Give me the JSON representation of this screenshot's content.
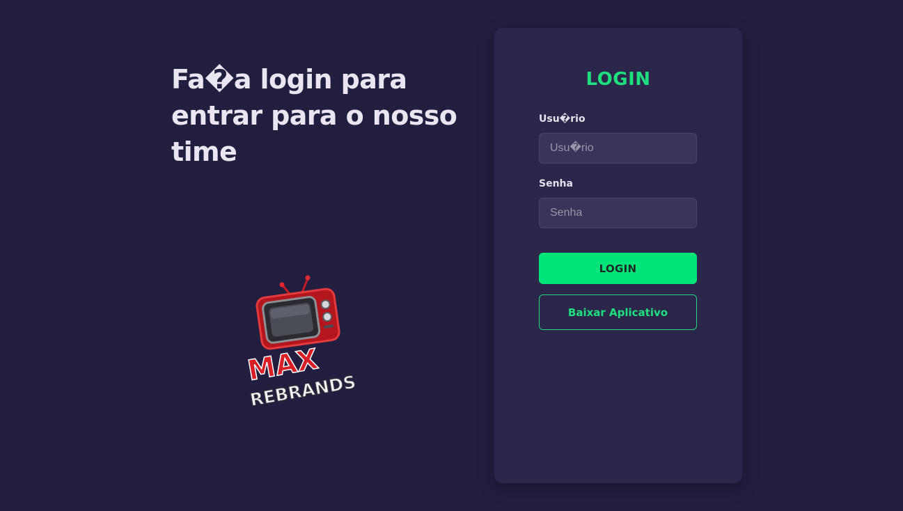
{
  "hero": {
    "title": "Fa�a login para entrar para o nosso time"
  },
  "logo": {
    "text_top": "MAX",
    "text_bottom": "REBRANDS"
  },
  "login_card": {
    "title": "LOGIN",
    "username": {
      "label": "Usu�rio",
      "placeholder": "Usu�rio",
      "value": ""
    },
    "password": {
      "label": "Senha",
      "placeholder": "Senha",
      "value": ""
    },
    "login_button_label": "LOGIN",
    "download_button_label": "Baixar Aplicativo"
  },
  "colors": {
    "background": "#221e3f",
    "card": "#2c264a",
    "accent": "#00e57a",
    "logo_red": "#d81f26"
  }
}
